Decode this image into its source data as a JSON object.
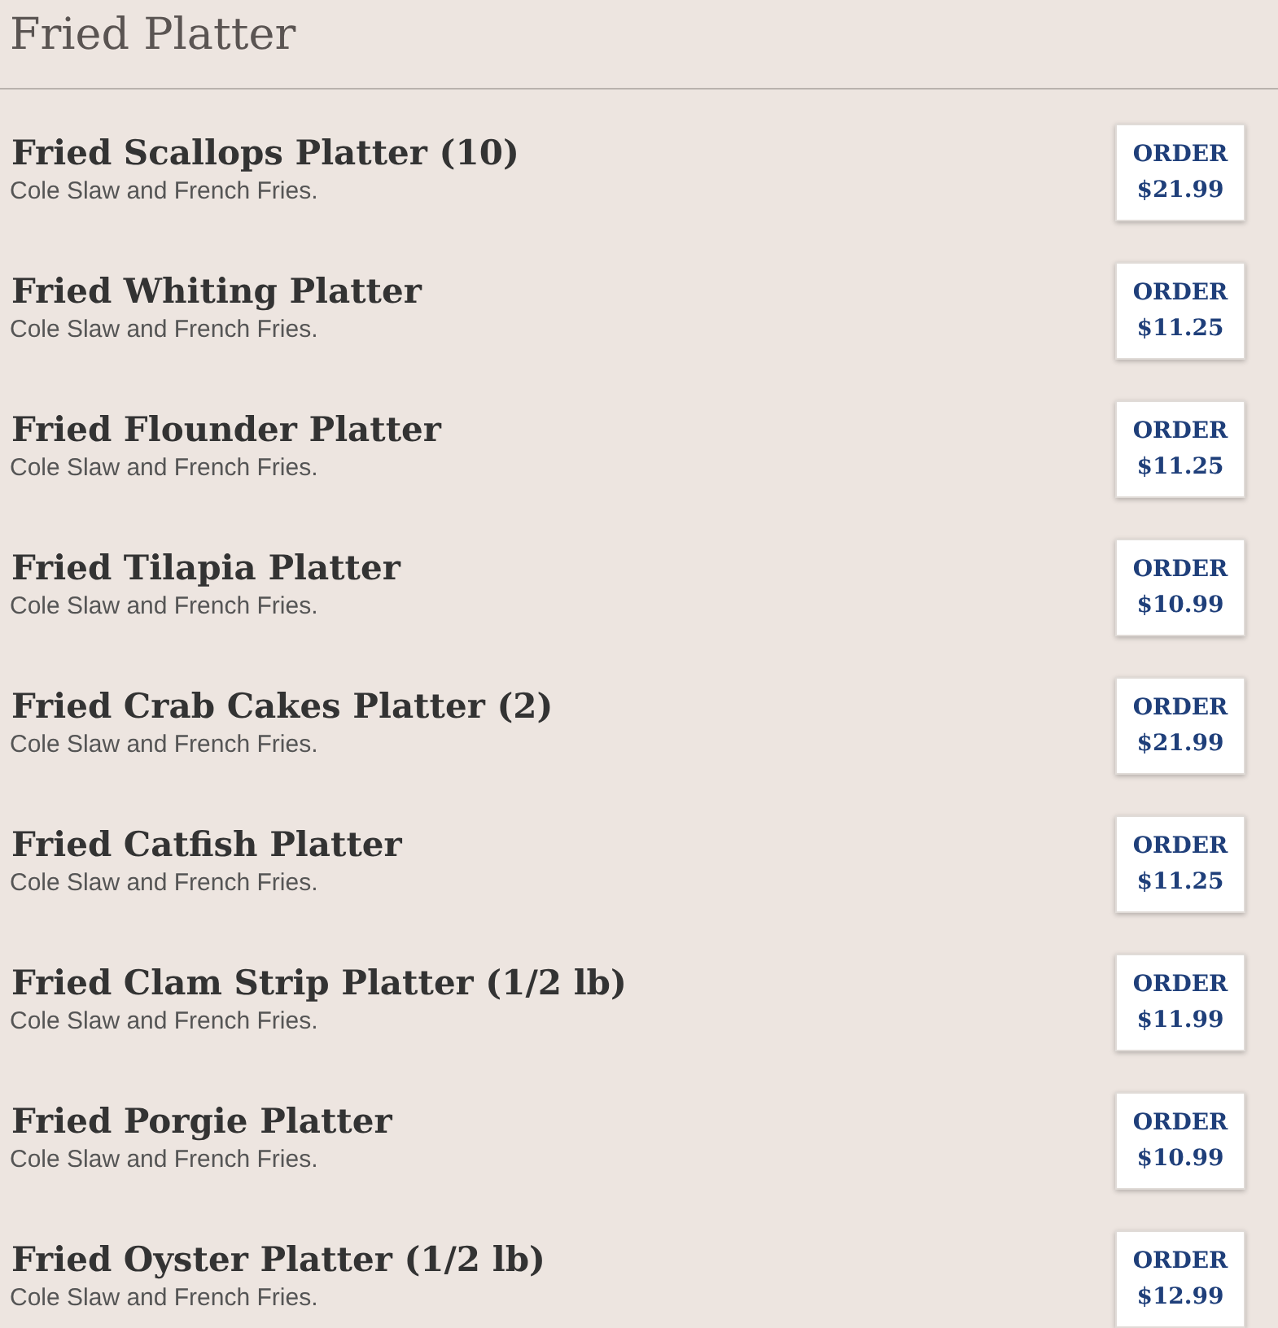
{
  "header": {
    "title": "Fried Platter"
  },
  "items": [
    {
      "name": "Fried Scallops Platter (10)",
      "description": "Cole Slaw and French Fries.",
      "button": "ORDER",
      "price": "$21.99"
    },
    {
      "name": "Fried Whiting Platter",
      "description": "Cole Slaw and French Fries.",
      "button": "ORDER",
      "price": "$11.25"
    },
    {
      "name": "Fried Flounder Platter",
      "description": "Cole Slaw and French Fries.",
      "button": "ORDER",
      "price": "$11.25"
    },
    {
      "name": "Fried Tilapia Platter",
      "description": "Cole Slaw and French Fries.",
      "button": "ORDER",
      "price": "$10.99"
    },
    {
      "name": "Fried Crab Cakes Platter (2)",
      "description": "Cole Slaw and French Fries.",
      "button": "ORDER",
      "price": "$21.99"
    },
    {
      "name": "Fried Catfish Platter",
      "description": "Cole Slaw and French Fries.",
      "button": "ORDER",
      "price": "$11.25"
    },
    {
      "name": "Fried Clam Strip Platter (1/2 lb)",
      "description": "Cole Slaw and French Fries.",
      "button": "ORDER",
      "price": "$11.99"
    },
    {
      "name": "Fried Porgie Platter",
      "description": "Cole Slaw and French Fries.",
      "button": "ORDER",
      "price": "$10.99"
    },
    {
      "name": "Fried Oyster Platter (1/2 lb)",
      "description": "Cole Slaw and French Fries.",
      "button": "ORDER",
      "price": "$12.99"
    }
  ]
}
